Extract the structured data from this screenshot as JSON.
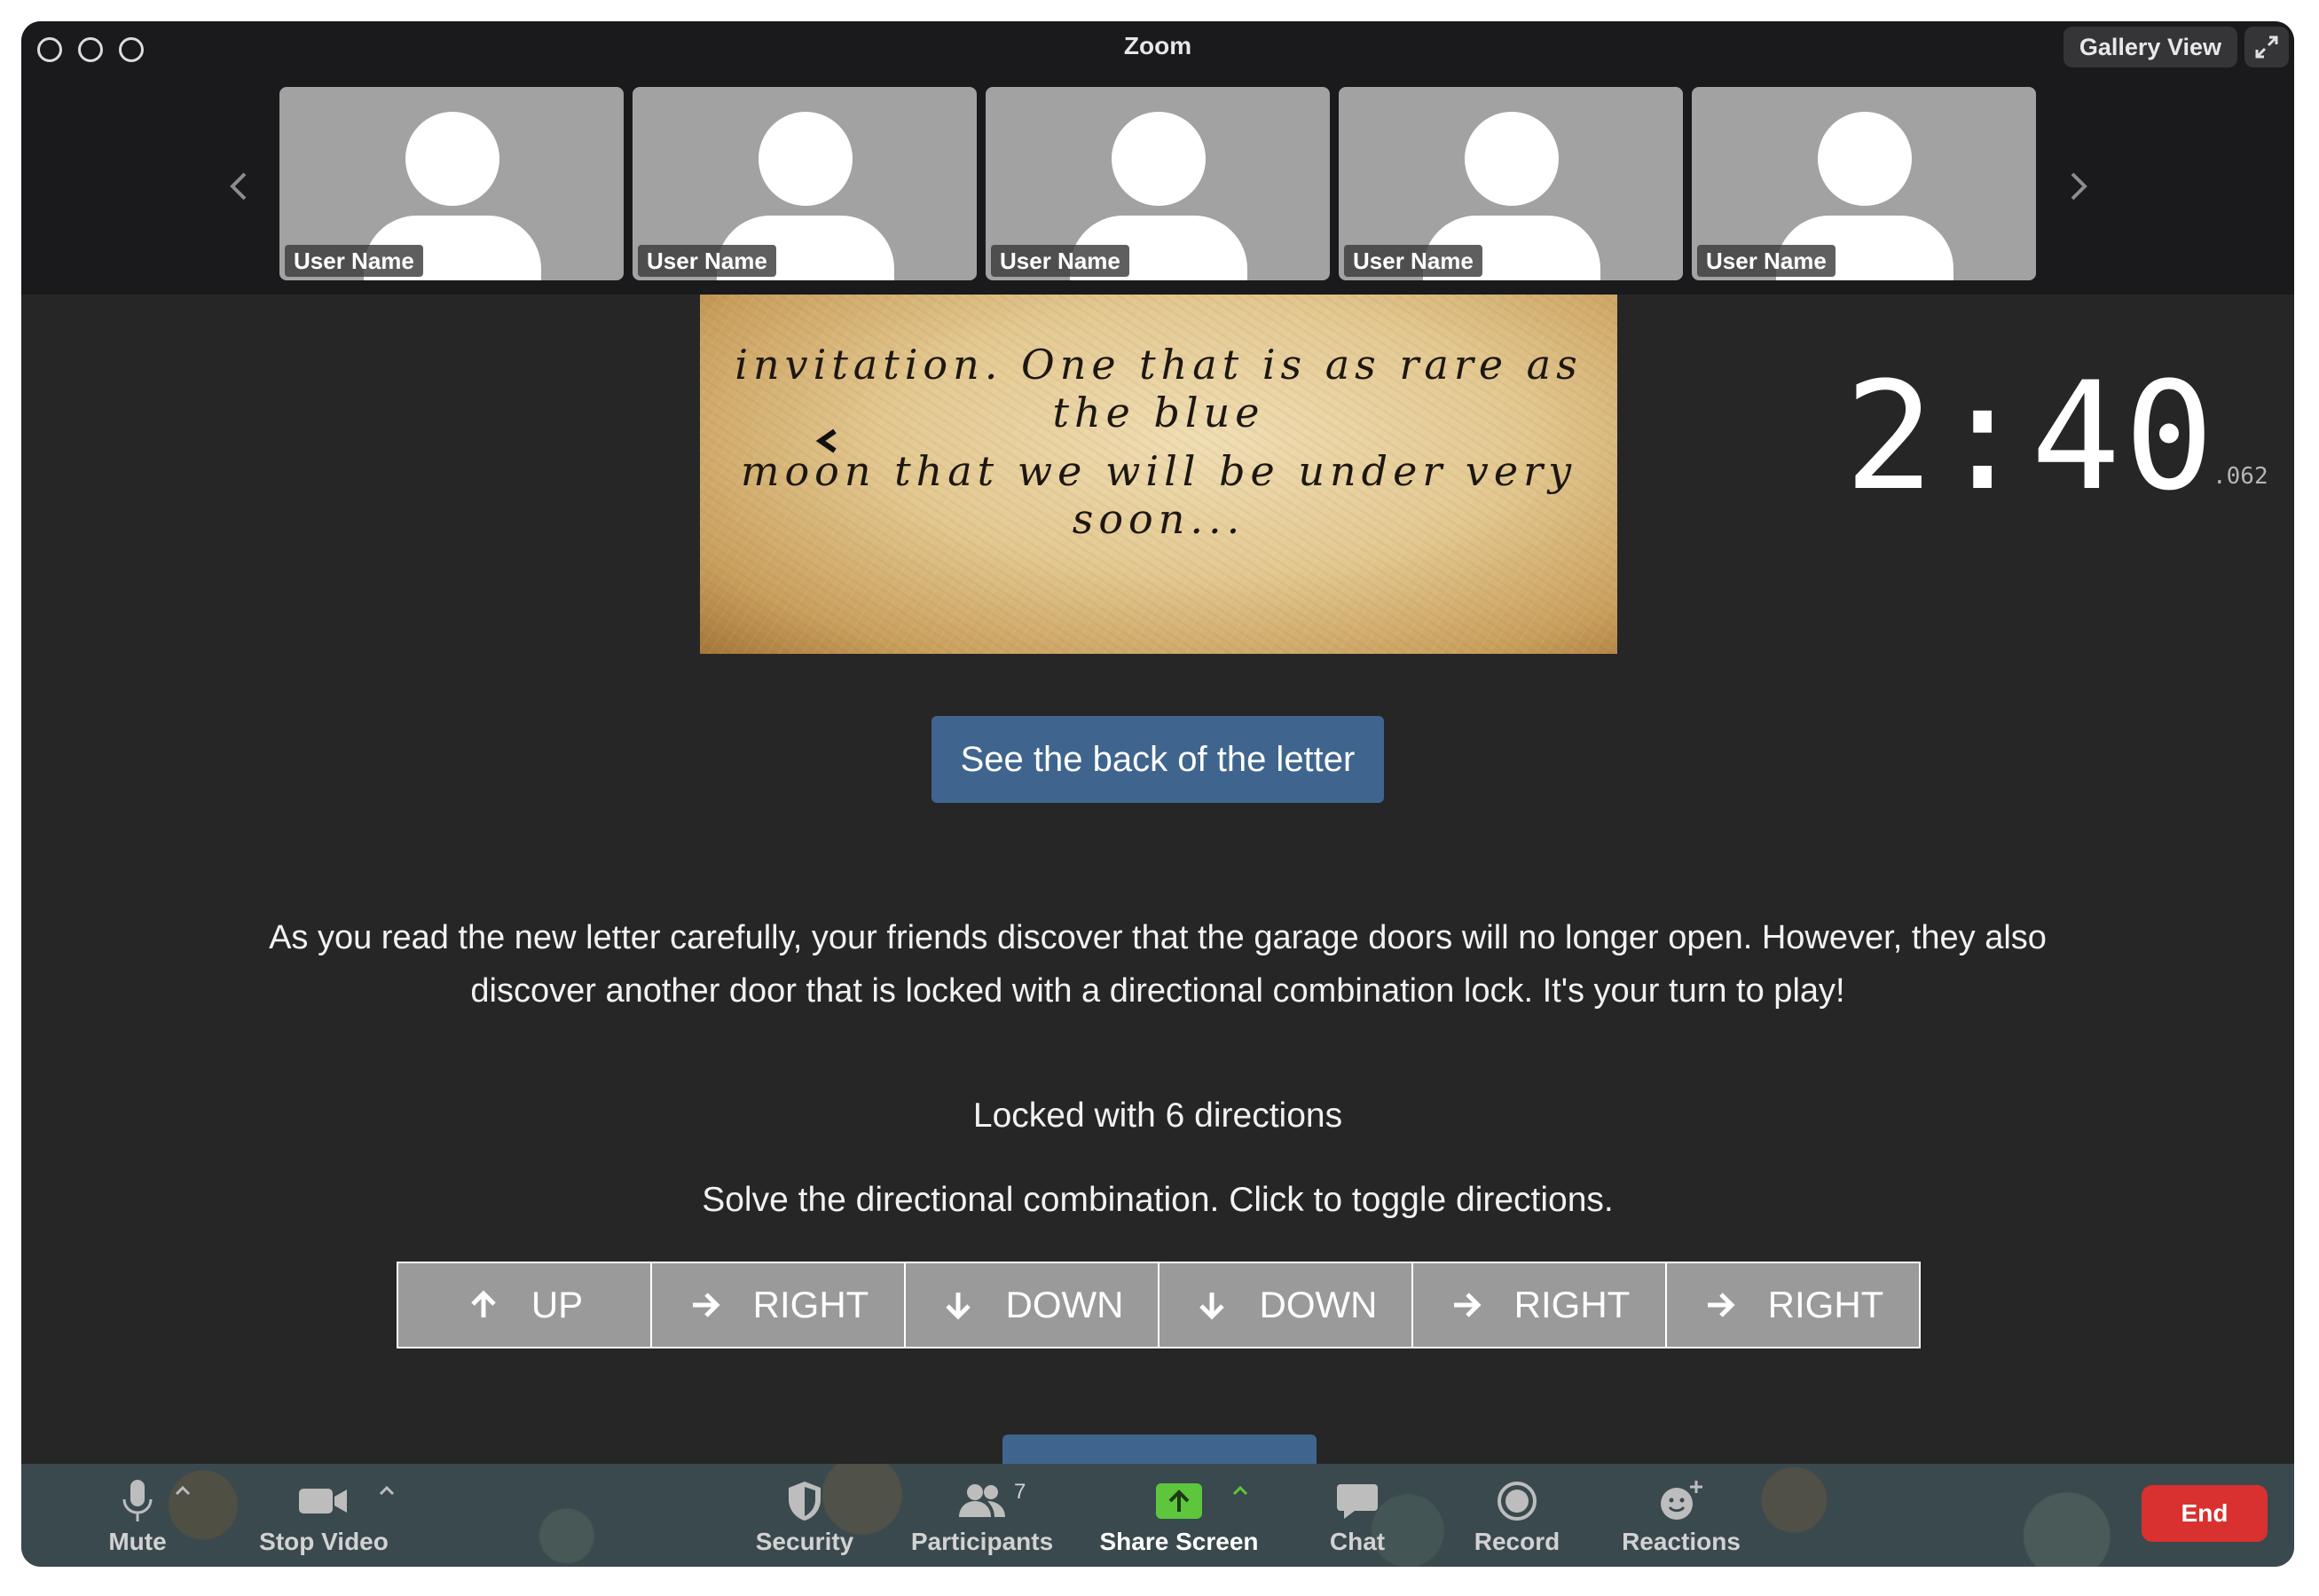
{
  "window": {
    "title": "Zoom",
    "gallery_view_label": "Gallery View"
  },
  "participants_strip": [
    {
      "name": "User Name"
    },
    {
      "name": "User Name"
    },
    {
      "name": "User Name"
    },
    {
      "name": "User Name"
    },
    {
      "name": "User Name"
    }
  ],
  "letter": {
    "line1": "invitation. One that is as rare as the blue",
    "line2": "moon that we will be under very soon..."
  },
  "timer": {
    "display": "2:40",
    "fraction": ".062"
  },
  "back_button_label": "See the back of the letter",
  "story_text": "As you read the new letter carefully, your friends discover that the garage doors will no longer open. However, they also discover another door that is locked with a directional combination lock. It's your turn to play!",
  "lock": {
    "title": "Locked with 6 directions",
    "instructions": "Solve the directional combination. Click to toggle directions.",
    "directions": [
      {
        "label": "UP",
        "icon": "arrow-up-icon"
      },
      {
        "label": "RIGHT",
        "icon": "arrow-right-icon"
      },
      {
        "label": "DOWN",
        "icon": "arrow-down-icon"
      },
      {
        "label": "DOWN",
        "icon": "arrow-down-icon"
      },
      {
        "label": "RIGHT",
        "icon": "arrow-right-icon"
      },
      {
        "label": "RIGHT",
        "icon": "arrow-right-icon"
      }
    ]
  },
  "toolbar": {
    "mute": "Mute",
    "stop_video": "Stop Video",
    "security": "Security",
    "participants": "Participants",
    "participants_count": "7",
    "share_screen": "Share Screen",
    "chat": "Chat",
    "record": "Record",
    "reactions": "Reactions",
    "end": "End"
  },
  "colors": {
    "accent_button": "#3f658e",
    "share_screen_green": "#5dc63c",
    "end_red": "#d93030"
  }
}
